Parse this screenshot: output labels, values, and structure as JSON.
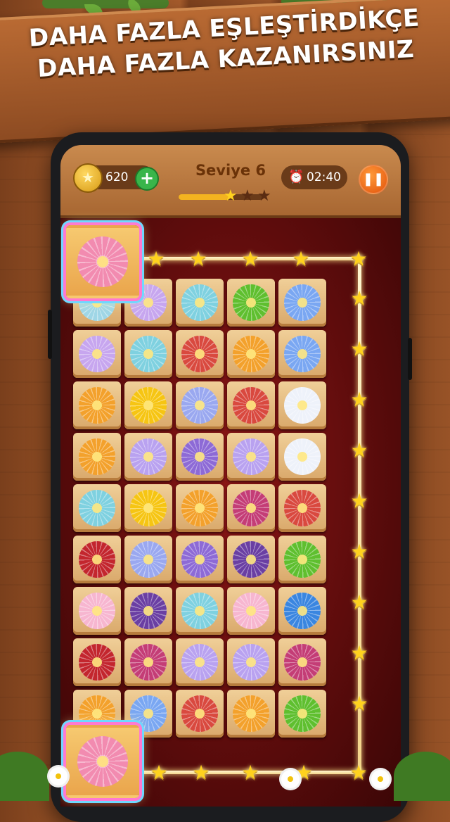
{
  "banner": {
    "line1": "DAHA FAZLA EŞLEŞTİRDİKÇE",
    "line2": "DAHA FAZLA KAZANIRSINIZ"
  },
  "hud": {
    "coins": "620",
    "coin_icon": "star-coin-icon",
    "add_icon": "+",
    "level_label": "Seviye 6",
    "level_progress": 0.6,
    "progress_stars_earned": 1,
    "progress_stars_total": 3,
    "timer": "02:40",
    "timer_icon": "alarm-clock-icon",
    "pause_icon": "❚❚"
  },
  "colors": {
    "pink": "#f28bb0",
    "lightblue": "#9fd6e6",
    "lavender": "#c7a6ef",
    "teal": "#7fd1e0",
    "green": "#5fbf2f",
    "blue": "#7aa7f2",
    "orange": "#f3a12c",
    "yellow": "#f6c513",
    "red": "#d9493f",
    "white": "#eef2fa",
    "purple": "#8d6ad6",
    "darkpurple": "#6a3fa3",
    "crimson": "#c3262e",
    "magenta": "#c43d76",
    "periwinkle": "#9aa8f0",
    "lilac": "#b9a2f0",
    "rosepink": "#f7b6d0",
    "cobalt": "#3a86e0",
    "palepink": "#f4b3cf"
  },
  "board": {
    "rows": [
      [
        "lightblue",
        "lavender",
        "teal",
        "green",
        "blue"
      ],
      [
        "lavender",
        "teal",
        "red",
        "orange",
        "blue"
      ],
      [
        "orange",
        "yellow",
        "periwinkle",
        "red",
        "white"
      ],
      [
        "orange",
        "lilac",
        "purple",
        "lilac",
        "white"
      ],
      [
        "teal",
        "yellow",
        "orange",
        "magenta",
        "red"
      ],
      [
        "crimson",
        "periwinkle",
        "purple",
        "darkpurple",
        "green"
      ],
      [
        "rosepink",
        "darkpurple",
        "teal",
        "rosepink",
        "cobalt"
      ],
      [
        "crimson",
        "magenta",
        "lilac",
        "lilac",
        "magenta"
      ],
      [
        "orange",
        "blue",
        "red",
        "orange",
        "green"
      ]
    ],
    "selected_top": "pink",
    "selected_bottom": "pink"
  }
}
